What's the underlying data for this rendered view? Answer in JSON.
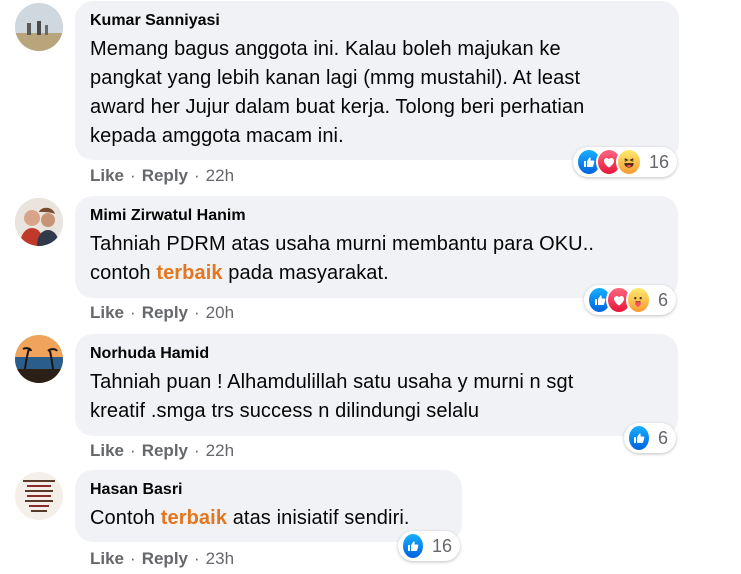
{
  "comments": [
    {
      "author": "Kumar Sanniyasi",
      "text_lines": [
        "Memang bagus anggota ini. Kalau boleh majukan ke",
        "pangkat yang lebih kanan lagi (mmg mustahil). At least",
        "award her Jujur dalam buat kerja. Tolong beri perhatian",
        "kepada amggota macam ini."
      ],
      "like": "Like",
      "reply": "Reply",
      "time": "22h",
      "reactions": [
        "like-icon",
        "love-icon",
        "haha-icon"
      ],
      "reaction_count": "16"
    },
    {
      "author": "Mimi Zirwatul Hanim",
      "line1": "Tahniah PDRM atas usaha murni membantu para OKU..",
      "line2_before": "contoh ",
      "keyword": "terbaik",
      "line2_after": " pada masyarakat.",
      "like": "Like",
      "reply": "Reply",
      "time": "20h",
      "reactions": [
        "like-icon",
        "love-icon",
        "care-icon"
      ],
      "reaction_count": "6"
    },
    {
      "author": "Norhuda Hamid",
      "text_lines": [
        "Tahniah puan ! Alhamdulillah satu usaha y murni n sgt",
        "kreatif .smga trs success n dilindungi selalu"
      ],
      "like": "Like",
      "reply": "Reply",
      "time": "22h",
      "reactions": [
        "like-icon"
      ],
      "reaction_count": "6"
    },
    {
      "author": "Hasan Basri",
      "line1_before": "Contoh ",
      "keyword": "terbaik",
      "line1_after": " atas inisiatif sendiri.",
      "like": "Like",
      "reply": "Reply",
      "time": "23h",
      "reactions": [
        "like-icon"
      ],
      "reaction_count": "16"
    }
  ],
  "colors": {
    "bubble": "#f0f2f5",
    "keyword": "#e4771d",
    "meta": "#65676b",
    "like_blue": "#0062df"
  }
}
